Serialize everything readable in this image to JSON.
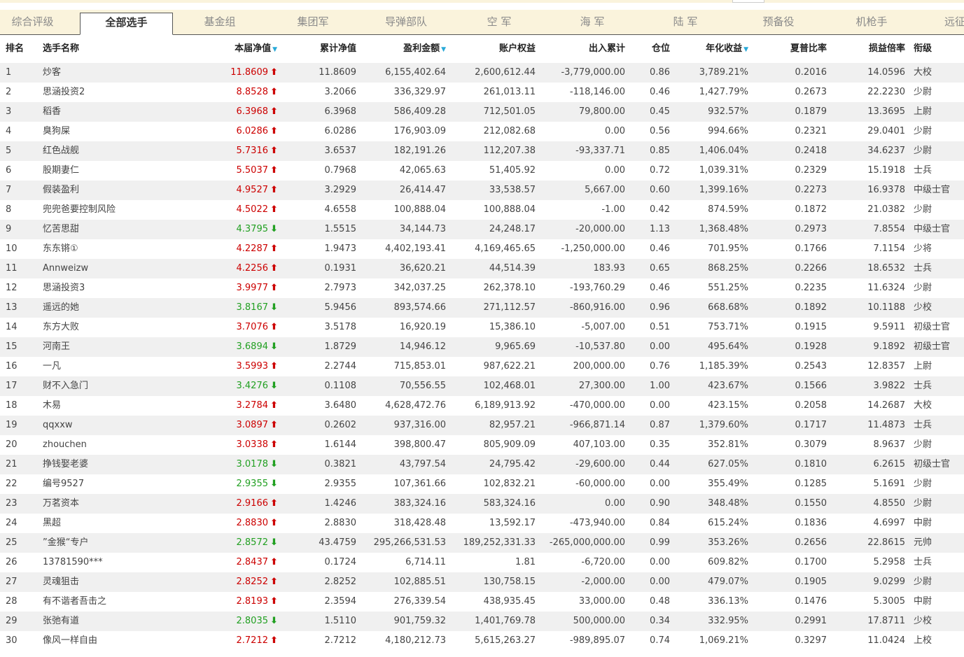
{
  "top_strip": {
    "frag_a": "",
    "red_a": "",
    "red_b": ""
  },
  "tabs": [
    {
      "label": "综合评级",
      "active": false
    },
    {
      "label": "全部选手",
      "active": true
    },
    {
      "label": "基金组",
      "active": false
    },
    {
      "label": "集团军",
      "active": false
    },
    {
      "label": "导弹部队",
      "active": false
    },
    {
      "label": "空 军",
      "active": false
    },
    {
      "label": "海 军",
      "active": false
    },
    {
      "label": "陆 军",
      "active": false
    },
    {
      "label": "预备役",
      "active": false
    },
    {
      "label": "机枪手",
      "active": false
    },
    {
      "label": "远征",
      "active": false
    }
  ],
  "columns": [
    {
      "key": "rank",
      "label": "排名",
      "sortable": false
    },
    {
      "key": "name",
      "label": "选手名称",
      "sortable": false
    },
    {
      "key": "nav",
      "label": "本届净值",
      "sortable": true
    },
    {
      "key": "cum_nav",
      "label": "累计净值",
      "sortable": false
    },
    {
      "key": "pnl",
      "label": "盈利金额",
      "sortable": true
    },
    {
      "key": "equity",
      "label": "账户权益",
      "sortable": false
    },
    {
      "key": "flow",
      "label": "出入累计",
      "sortable": false
    },
    {
      "key": "position",
      "label": "仓位",
      "sortable": false
    },
    {
      "key": "annual",
      "label": "年化收益",
      "sortable": true
    },
    {
      "key": "sharpe",
      "label": "夏普比率",
      "sortable": false
    },
    {
      "key": "pl_ratio",
      "label": "损益倍率",
      "sortable": false
    },
    {
      "key": "title",
      "label": "衔级",
      "sortable": false
    }
  ],
  "rows": [
    {
      "rank": "1",
      "name": "炒客",
      "nav": "11.8609",
      "dir": "up",
      "cum_nav": "11.8609",
      "pnl": "6,155,402.64",
      "equity": "2,600,612.44",
      "flow": "-3,779,000.00",
      "position": "0.86",
      "annual": "3,789.21%",
      "sharpe": "0.2016",
      "pl_ratio": "14.0596",
      "title": "大校"
    },
    {
      "rank": "2",
      "name": "思涵投资2",
      "nav": "8.8528",
      "dir": "up",
      "cum_nav": "3.2066",
      "pnl": "336,329.97",
      "equity": "261,013.11",
      "flow": "-118,146.00",
      "position": "0.46",
      "annual": "1,427.79%",
      "sharpe": "0.2673",
      "pl_ratio": "22.2230",
      "title": "少尉"
    },
    {
      "rank": "3",
      "name": "稻香",
      "nav": "6.3968",
      "dir": "up",
      "cum_nav": "6.3968",
      "pnl": "586,409.28",
      "equity": "712,501.05",
      "flow": "79,800.00",
      "position": "0.45",
      "annual": "932.57%",
      "sharpe": "0.1879",
      "pl_ratio": "13.3695",
      "title": "上尉"
    },
    {
      "rank": "4",
      "name": "臭狗屎",
      "nav": "6.0286",
      "dir": "up",
      "cum_nav": "6.0286",
      "pnl": "176,903.09",
      "equity": "212,082.68",
      "flow": "0.00",
      "position": "0.56",
      "annual": "994.66%",
      "sharpe": "0.2321",
      "pl_ratio": "29.0401",
      "title": "少尉"
    },
    {
      "rank": "5",
      "name": "红色战舰",
      "nav": "5.7316",
      "dir": "up",
      "cum_nav": "3.6537",
      "pnl": "182,191.26",
      "equity": "112,207.38",
      "flow": "-93,337.71",
      "position": "0.85",
      "annual": "1,406.04%",
      "sharpe": "0.2418",
      "pl_ratio": "34.6237",
      "title": "少尉"
    },
    {
      "rank": "6",
      "name": "股期妻仁",
      "nav": "5.5037",
      "dir": "up",
      "cum_nav": "0.7968",
      "pnl": "42,065.63",
      "equity": "51,405.92",
      "flow": "0.00",
      "position": "0.72",
      "annual": "1,039.31%",
      "sharpe": "0.2329",
      "pl_ratio": "15.1918",
      "title": "士兵"
    },
    {
      "rank": "7",
      "name": "假装盈利",
      "nav": "4.9527",
      "dir": "up",
      "cum_nav": "3.2929",
      "pnl": "26,414.47",
      "equity": "33,538.57",
      "flow": "5,667.00",
      "position": "0.60",
      "annual": "1,399.16%",
      "sharpe": "0.2273",
      "pl_ratio": "16.9378",
      "title": "中级士官"
    },
    {
      "rank": "8",
      "name": "兜兜爸要控制风险",
      "nav": "4.5022",
      "dir": "up",
      "cum_nav": "4.6558",
      "pnl": "100,888.04",
      "equity": "100,888.04",
      "flow": "-1.00",
      "position": "0.42",
      "annual": "874.59%",
      "sharpe": "0.1872",
      "pl_ratio": "21.0382",
      "title": "少尉"
    },
    {
      "rank": "9",
      "name": "忆苦思甜",
      "nav": "4.3795",
      "dir": "down",
      "cum_nav": "1.5515",
      "pnl": "34,144.73",
      "equity": "24,248.17",
      "flow": "-20,000.00",
      "position": "1.13",
      "annual": "1,368.48%",
      "sharpe": "0.2973",
      "pl_ratio": "7.8554",
      "title": "中级士官"
    },
    {
      "rank": "10",
      "name": "东东锵①",
      "nav": "4.2287",
      "dir": "up",
      "cum_nav": "1.9473",
      "pnl": "4,402,193.41",
      "equity": "4,169,465.65",
      "flow": "-1,250,000.00",
      "position": "0.46",
      "annual": "701.95%",
      "sharpe": "0.1766",
      "pl_ratio": "7.1154",
      "title": "少将"
    },
    {
      "rank": "11",
      "name": "Annweizw",
      "nav": "4.2256",
      "dir": "up",
      "cum_nav": "0.1931",
      "pnl": "36,620.21",
      "equity": "44,514.39",
      "flow": "183.93",
      "position": "0.65",
      "annual": "868.25%",
      "sharpe": "0.2266",
      "pl_ratio": "18.6532",
      "title": "士兵"
    },
    {
      "rank": "12",
      "name": "思涵投资3",
      "nav": "3.9977",
      "dir": "up",
      "cum_nav": "2.7973",
      "pnl": "342,037.25",
      "equity": "262,378.10",
      "flow": "-193,760.29",
      "position": "0.46",
      "annual": "551.25%",
      "sharpe": "0.2235",
      "pl_ratio": "11.6324",
      "title": "少尉"
    },
    {
      "rank": "13",
      "name": "遥远的她",
      "nav": "3.8167",
      "dir": "down",
      "cum_nav": "5.9456",
      "pnl": "893,574.66",
      "equity": "271,112.57",
      "flow": "-860,916.00",
      "position": "0.96",
      "annual": "668.68%",
      "sharpe": "0.1892",
      "pl_ratio": "10.1188",
      "title": "少校"
    },
    {
      "rank": "14",
      "name": "东方大败",
      "nav": "3.7076",
      "dir": "up",
      "cum_nav": "3.5178",
      "pnl": "16,920.19",
      "equity": "15,386.10",
      "flow": "-5,007.00",
      "position": "0.51",
      "annual": "753.71%",
      "sharpe": "0.1915",
      "pl_ratio": "9.5911",
      "title": "初级士官"
    },
    {
      "rank": "15",
      "name": "河南王",
      "nav": "3.6894",
      "dir": "down",
      "cum_nav": "1.8729",
      "pnl": "14,946.12",
      "equity": "9,965.69",
      "flow": "-10,537.80",
      "position": "0.00",
      "annual": "495.64%",
      "sharpe": "0.1928",
      "pl_ratio": "9.1892",
      "title": "初级士官"
    },
    {
      "rank": "16",
      "name": "一凡",
      "nav": "3.5993",
      "dir": "up",
      "cum_nav": "2.2744",
      "pnl": "715,853.01",
      "equity": "987,622.21",
      "flow": "200,000.00",
      "position": "0.76",
      "annual": "1,185.39%",
      "sharpe": "0.2543",
      "pl_ratio": "12.8357",
      "title": "上尉"
    },
    {
      "rank": "17",
      "name": "财不入急门",
      "nav": "3.4276",
      "dir": "down",
      "cum_nav": "0.1108",
      "pnl": "70,556.55",
      "equity": "102,468.01",
      "flow": "27,300.00",
      "position": "1.00",
      "annual": "423.67%",
      "sharpe": "0.1566",
      "pl_ratio": "3.9822",
      "title": "士兵"
    },
    {
      "rank": "18",
      "name": "木易",
      "nav": "3.2784",
      "dir": "up",
      "cum_nav": "3.6480",
      "pnl": "4,628,472.76",
      "equity": "6,189,913.92",
      "flow": "-470,000.00",
      "position": "0.00",
      "annual": "423.15%",
      "sharpe": "0.2058",
      "pl_ratio": "14.2687",
      "title": "大校"
    },
    {
      "rank": "19",
      "name": "qqxxw",
      "nav": "3.0897",
      "dir": "up",
      "cum_nav": "0.2602",
      "pnl": "937,316.00",
      "equity": "82,957.21",
      "flow": "-966,871.14",
      "position": "0.87",
      "annual": "1,379.60%",
      "sharpe": "0.1717",
      "pl_ratio": "11.4873",
      "title": "士兵"
    },
    {
      "rank": "20",
      "name": "zhouchen",
      "nav": "3.0338",
      "dir": "up",
      "cum_nav": "1.6144",
      "pnl": "398,800.47",
      "equity": "805,909.09",
      "flow": "407,103.00",
      "position": "0.35",
      "annual": "352.81%",
      "sharpe": "0.3079",
      "pl_ratio": "8.9637",
      "title": "少尉"
    },
    {
      "rank": "21",
      "name": "挣钱娶老婆",
      "nav": "3.0178",
      "dir": "down",
      "cum_nav": "0.3821",
      "pnl": "43,797.54",
      "equity": "24,795.42",
      "flow": "-29,600.00",
      "position": "0.44",
      "annual": "627.05%",
      "sharpe": "0.1810",
      "pl_ratio": "6.2615",
      "title": "初级士官"
    },
    {
      "rank": "22",
      "name": "编号9527",
      "nav": "2.9355",
      "dir": "down",
      "cum_nav": "2.9355",
      "pnl": "107,361.66",
      "equity": "102,832.21",
      "flow": "-60,000.00",
      "position": "0.00",
      "annual": "355.49%",
      "sharpe": "0.1285",
      "pl_ratio": "5.1691",
      "title": "少尉"
    },
    {
      "rank": "23",
      "name": "万茗资本",
      "nav": "2.9166",
      "dir": "up",
      "cum_nav": "1.4246",
      "pnl": "383,324.16",
      "equity": "583,324.16",
      "flow": "0.00",
      "position": "0.90",
      "annual": "348.48%",
      "sharpe": "0.1550",
      "pl_ratio": "4.8550",
      "title": "少尉"
    },
    {
      "rank": "24",
      "name": "黑超",
      "nav": "2.8830",
      "dir": "up",
      "cum_nav": "2.8830",
      "pnl": "318,428.48",
      "equity": "13,592.17",
      "flow": "-473,940.00",
      "position": "0.84",
      "annual": "615.24%",
      "sharpe": "0.1836",
      "pl_ratio": "4.6997",
      "title": "中尉"
    },
    {
      "rank": "25",
      "name": "”金猴“专户",
      "nav": "2.8572",
      "dir": "down",
      "cum_nav": "43.4759",
      "pnl": "295,266,531.53",
      "equity": "189,252,331.33",
      "flow": "-265,000,000.00",
      "position": "0.99",
      "annual": "353.26%",
      "sharpe": "0.2656",
      "pl_ratio": "22.8615",
      "title": "元帅"
    },
    {
      "rank": "26",
      "name": "13781590***",
      "nav": "2.8437",
      "dir": "up",
      "cum_nav": "0.1724",
      "pnl": "6,714.11",
      "equity": "1.81",
      "flow": "-6,720.00",
      "position": "0.00",
      "annual": "609.82%",
      "sharpe": "0.1700",
      "pl_ratio": "5.2958",
      "title": "士兵"
    },
    {
      "rank": "27",
      "name": "灵魂狙击",
      "nav": "2.8252",
      "dir": "up",
      "cum_nav": "2.8252",
      "pnl": "102,885.51",
      "equity": "130,758.15",
      "flow": "-2,000.00",
      "position": "0.00",
      "annual": "479.07%",
      "sharpe": "0.1905",
      "pl_ratio": "9.0299",
      "title": "少尉"
    },
    {
      "rank": "28",
      "name": "有不谐者吾击之",
      "nav": "2.8193",
      "dir": "up",
      "cum_nav": "2.3594",
      "pnl": "276,339.54",
      "equity": "438,935.45",
      "flow": "33,000.00",
      "position": "0.48",
      "annual": "336.13%",
      "sharpe": "0.1476",
      "pl_ratio": "5.3005",
      "title": "中尉"
    },
    {
      "rank": "29",
      "name": "张弛有道",
      "nav": "2.8035",
      "dir": "down",
      "cum_nav": "1.5110",
      "pnl": "901,759.32",
      "equity": "1,401,769.78",
      "flow": "500,000.00",
      "position": "0.34",
      "annual": "332.95%",
      "sharpe": "0.2991",
      "pl_ratio": "17.8711",
      "title": "少校"
    },
    {
      "rank": "30",
      "name": "像风一样自由",
      "nav": "2.7212",
      "dir": "up",
      "cum_nav": "2.7212",
      "pnl": "4,180,212.73",
      "equity": "5,615,263.27",
      "flow": "-989,895.07",
      "position": "0.74",
      "annual": "1,069.21%",
      "sharpe": "0.3297",
      "pl_ratio": "11.0424",
      "title": "上校"
    }
  ],
  "colors": {
    "up": "#cc0000",
    "down": "#22a022",
    "sort_icon": "#29a9d8",
    "tabbar_bg": "#faf3dc",
    "alt_row": "#f0f0f0"
  },
  "icons": {
    "up": "arrow-up-icon",
    "down": "arrow-down-icon",
    "sort": "sort-desc-icon"
  }
}
